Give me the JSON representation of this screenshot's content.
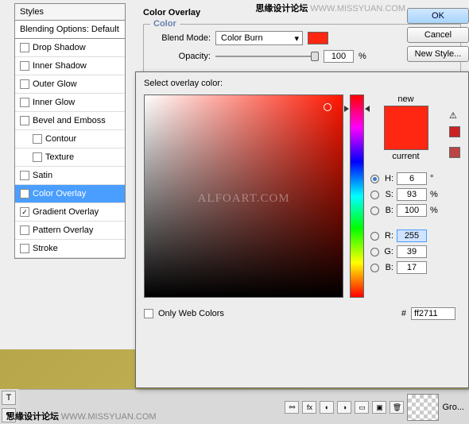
{
  "watermark_top": {
    "a": "思缘设计论坛",
    "b": "WWW.MISSYUAN.COM"
  },
  "watermark_bottom": {
    "a": "思缘设计论坛",
    "b": "WWW.MISSYUAN.COM"
  },
  "styles": {
    "header": "Styles",
    "sub": "Blending Options: Default",
    "items": [
      {
        "label": "Drop Shadow",
        "checked": false
      },
      {
        "label": "Inner Shadow",
        "checked": false
      },
      {
        "label": "Outer Glow",
        "checked": false
      },
      {
        "label": "Inner Glow",
        "checked": false
      },
      {
        "label": "Bevel and Emboss",
        "checked": false
      },
      {
        "label": "Contour",
        "checked": false,
        "indent": true
      },
      {
        "label": "Texture",
        "checked": false,
        "indent": true
      },
      {
        "label": "Satin",
        "checked": false
      },
      {
        "label": "Color Overlay",
        "checked": true,
        "selected": true
      },
      {
        "label": "Gradient Overlay",
        "checked": true
      },
      {
        "label": "Pattern Overlay",
        "checked": false
      },
      {
        "label": "Stroke",
        "checked": false
      }
    ]
  },
  "overlay": {
    "title": "Color Overlay",
    "fieldset": "Color",
    "blend_label": "Blend Mode:",
    "blend_value": "Color Burn",
    "opacity_label": "Opacity:",
    "opacity_value": "100",
    "opacity_unit": "%",
    "swatch": "#ff2711"
  },
  "buttons": {
    "ok": "OK",
    "cancel": "Cancel",
    "newstyle": "New Style..."
  },
  "picker": {
    "title": "Select overlay color:",
    "new": "new",
    "current": "current",
    "only_web": "Only Web Colors",
    "H": {
      "label": "H:",
      "value": "6",
      "unit": "°"
    },
    "S": {
      "label": "S:",
      "value": "93",
      "unit": "%"
    },
    "B": {
      "label": "B:",
      "value": "100",
      "unit": "%"
    },
    "R": {
      "label": "R:",
      "value": "255",
      "unit": ""
    },
    "G": {
      "label": "G:",
      "value": "39",
      "unit": ""
    },
    "Bb": {
      "label": "B:",
      "value": "17",
      "unit": ""
    },
    "hex_label": "#",
    "hex": "ff2711",
    "center_wm": "ALFOART.COM"
  },
  "layers": {
    "group": "Gro...",
    "fx": "fx"
  }
}
